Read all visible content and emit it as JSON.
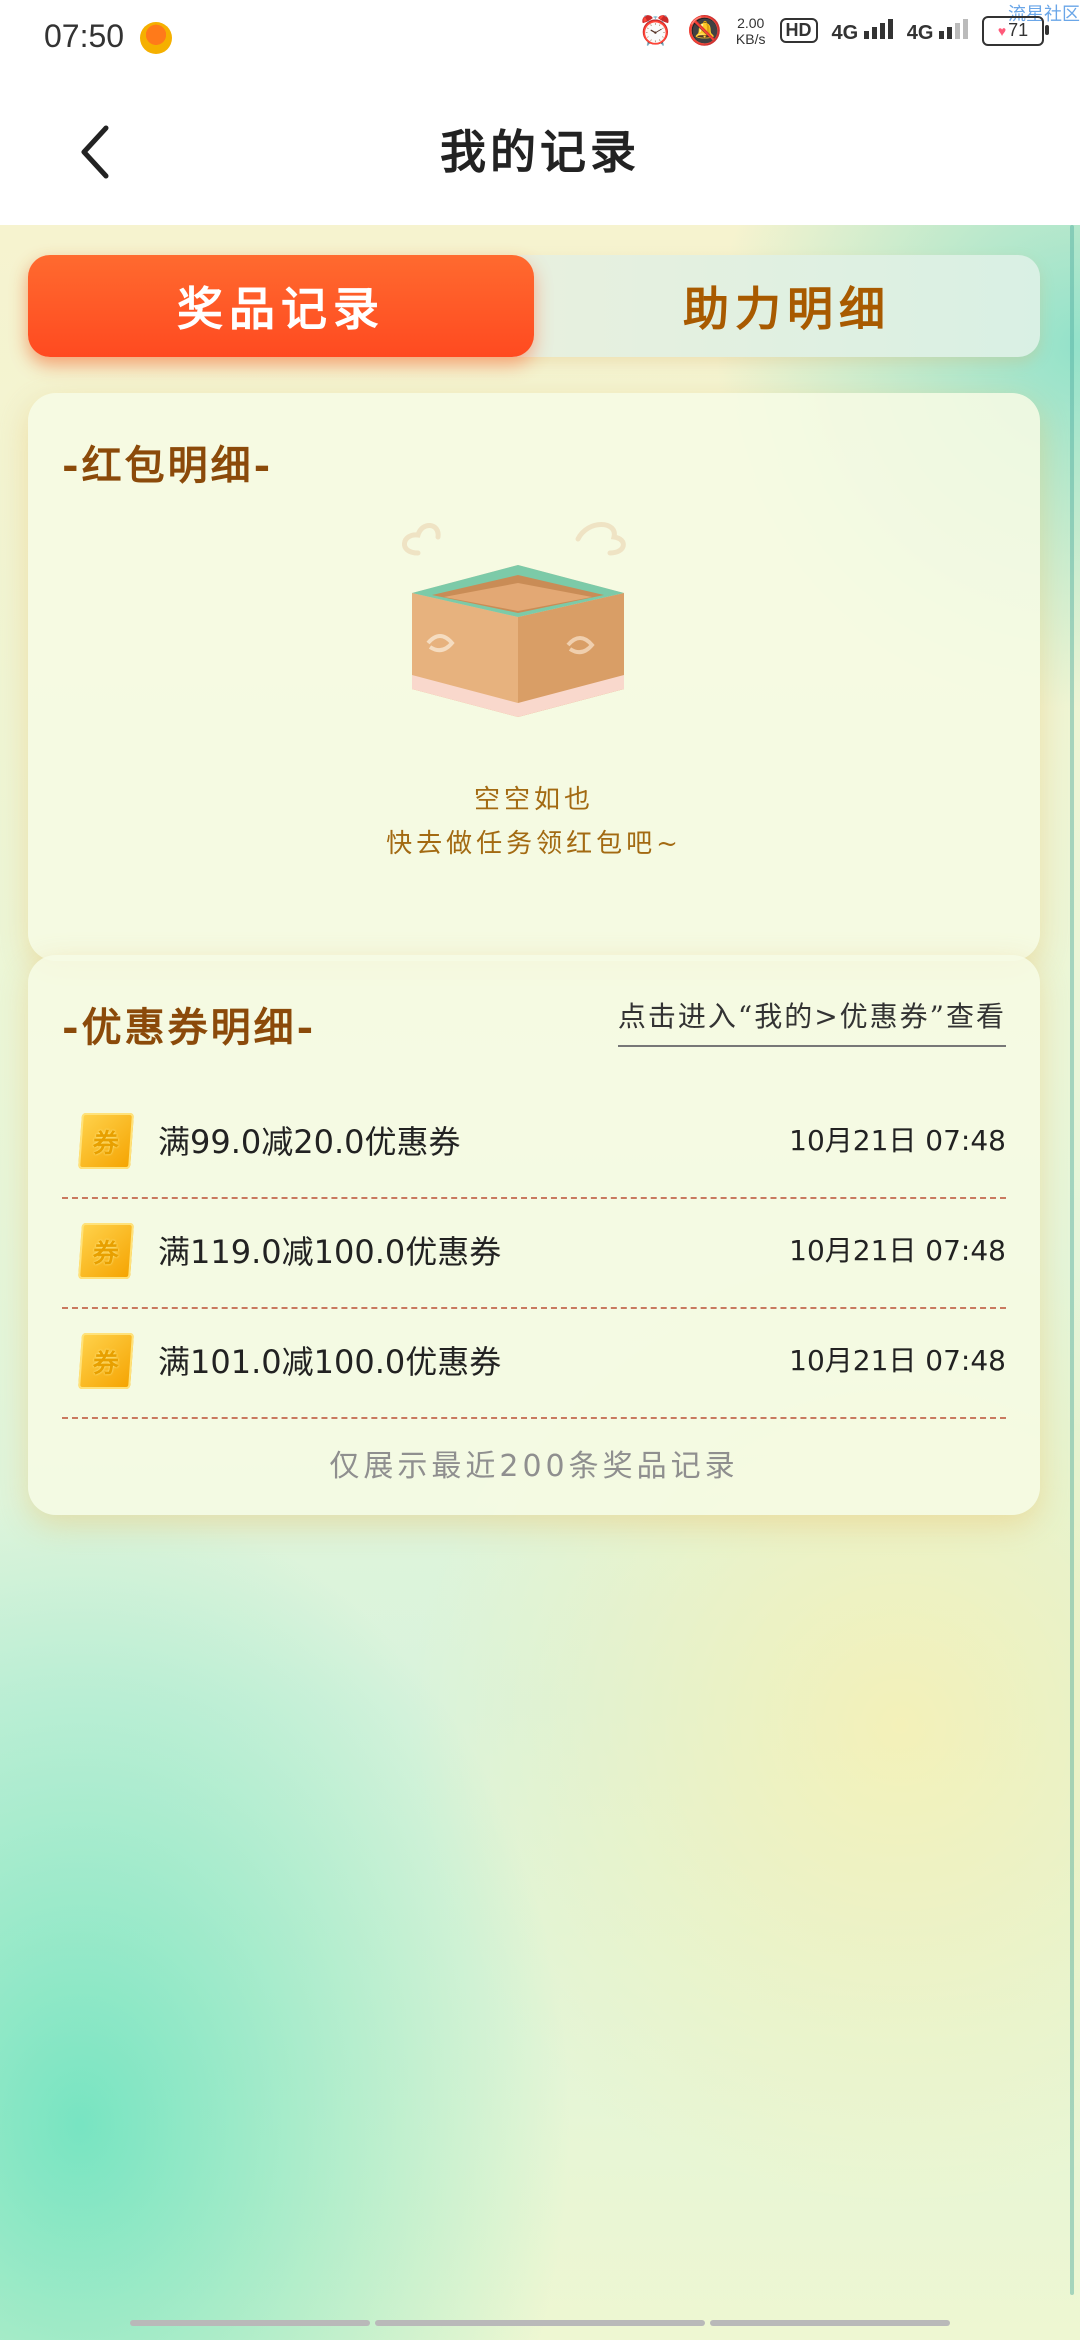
{
  "status_bar": {
    "time": "07:50",
    "speed_value": "2.00",
    "speed_unit": "KB/s",
    "hd_label": "HD",
    "sim1_net": "4G",
    "sim2_net": "4G",
    "battery": "71",
    "watermark": "流星社区"
  },
  "header": {
    "title": "我的记录"
  },
  "tabs": [
    {
      "label": "奖品记录",
      "active": true
    },
    {
      "label": "助力明细",
      "active": false
    }
  ],
  "red_packet": {
    "title": "-红包明细-",
    "empty_title": "空空如也",
    "empty_subtitle": "快去做任务领红包吧~"
  },
  "coupons": {
    "title": "-优惠券明细-",
    "view_link": "点击进入“我的>优惠券”查看",
    "ticket_icon_text": "券",
    "items": [
      {
        "name": "满99.0减20.0优惠券",
        "time": "10月21日 07:48"
      },
      {
        "name": "满119.0减100.0优惠券",
        "time": "10月21日 07:48"
      },
      {
        "name": "满101.0减100.0优惠券",
        "time": "10月21日 07:48"
      }
    ],
    "footnote": "仅展示最近200条奖品记录"
  }
}
